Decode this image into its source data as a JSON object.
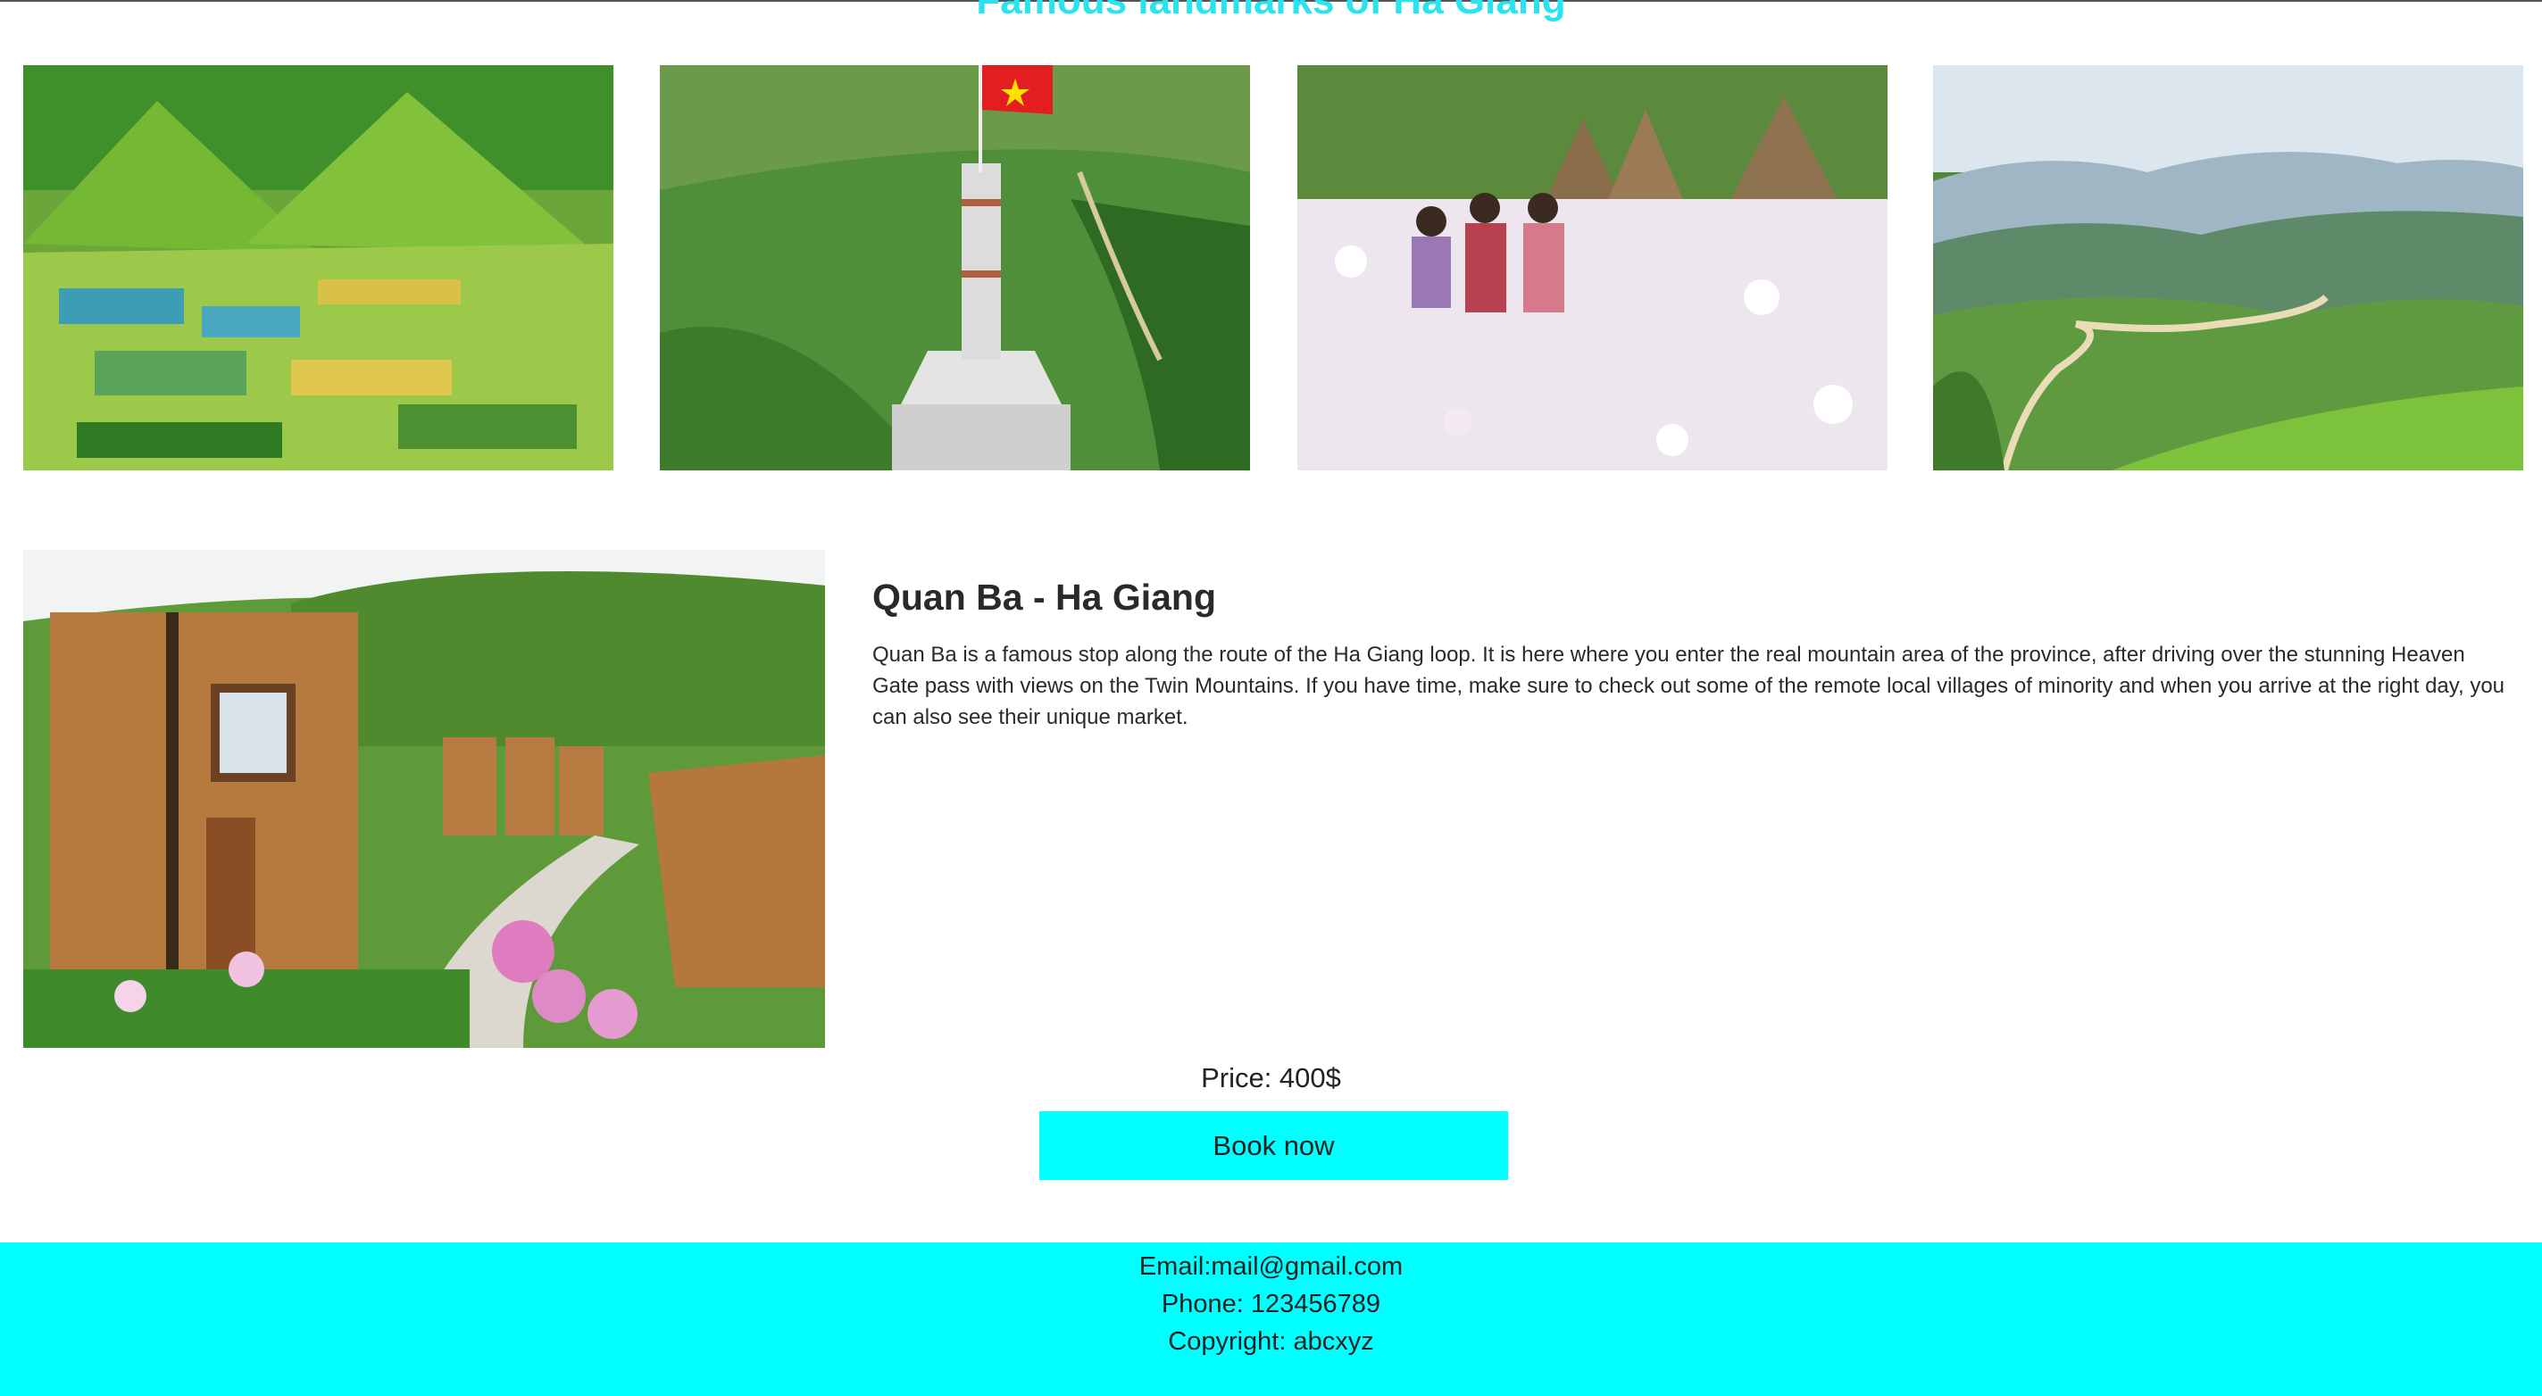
{
  "landmarks": {
    "title": "Famous landmarks of Ha Giang",
    "photos": [
      {
        "icon": "twin-mountains-photo"
      },
      {
        "icon": "flag-tower-photo"
      },
      {
        "icon": "flower-field-children-photo"
      },
      {
        "icon": "mountain-road-photo"
      }
    ]
  },
  "tour": {
    "image_icon": "quan-ba-homestay-photo",
    "title": "Quan Ba - Ha Giang",
    "description": "Quan Ba is a famous stop along the route of the Ha Giang loop. It is here where you enter the real mountain area of the province, after driving over the stunning Heaven Gate pass with views on the Twin Mountains. If you have time, make sure to check out some of the remote local villages of minority and when you arrive at the right day, you can also see their unique market.",
    "price": "Price: 400$",
    "book_label": "Book now"
  },
  "footer": {
    "email": "Email:mail@gmail.com",
    "phone": "Phone: 123456789",
    "copyright": "Copyright: abcxyz"
  },
  "colors": {
    "accent": "#00ffff",
    "title": "#29e3ee",
    "text": "#222222"
  }
}
